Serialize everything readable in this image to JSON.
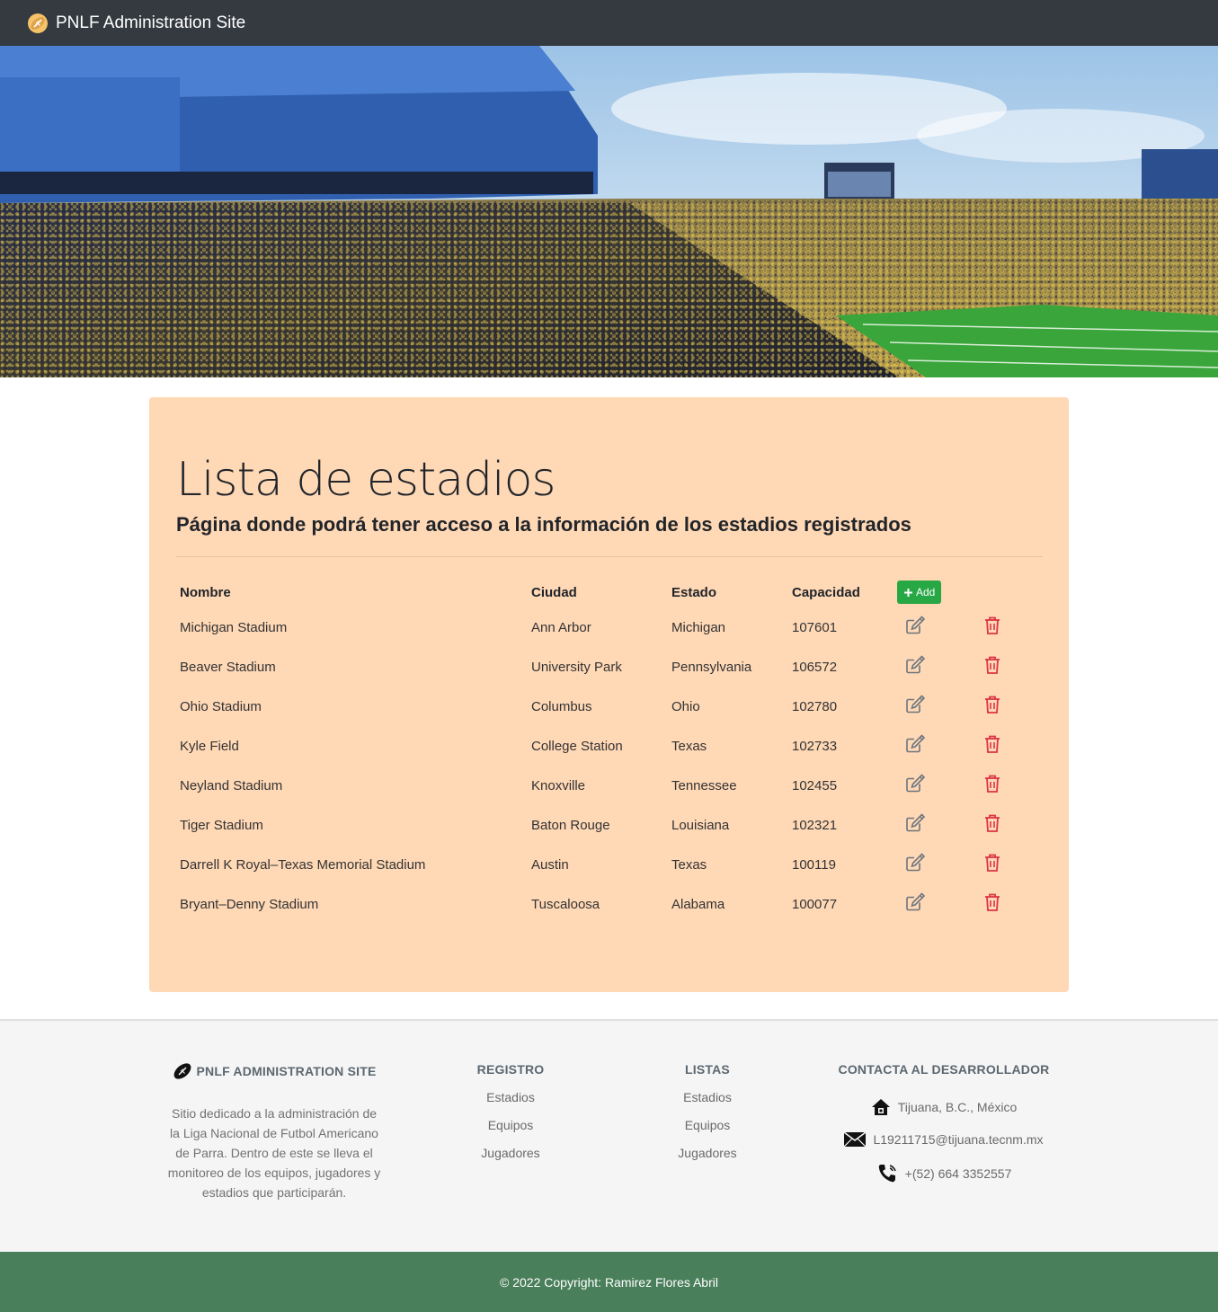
{
  "navbar": {
    "brand": "PNLF Administration Site",
    "brand_icon": "football-icon"
  },
  "hero": {
    "image": "stadium-crowd-photo"
  },
  "page": {
    "title": "Lista de estadios",
    "subtitle": "Página donde podrá tener acceso a la información de los estadios registrados"
  },
  "table": {
    "headers": {
      "name": "Nombre",
      "city": "Ciudad",
      "state": "Estado",
      "capacity": "Capacidad"
    },
    "add_button": "Add",
    "rows": [
      {
        "name": "Michigan Stadium",
        "city": "Ann Arbor",
        "state": "Michigan",
        "capacity": "107601"
      },
      {
        "name": "Beaver Stadium",
        "city": "University Park",
        "state": "Pennsylvania",
        "capacity": "106572"
      },
      {
        "name": "Ohio Stadium",
        "city": "Columbus",
        "state": "Ohio",
        "capacity": "102780"
      },
      {
        "name": "Kyle Field",
        "city": "College Station",
        "state": "Texas",
        "capacity": "102733"
      },
      {
        "name": "Neyland Stadium",
        "city": "Knoxville",
        "state": "Tennessee",
        "capacity": "102455"
      },
      {
        "name": "Tiger Stadium",
        "city": "Baton Rouge",
        "state": "Louisiana",
        "capacity": "102321"
      },
      {
        "name": "Darrell K Royal–Texas Memorial Stadium",
        "city": "Austin",
        "state": "Texas",
        "capacity": "100119"
      },
      {
        "name": "Bryant–Denny Stadium",
        "city": "Tuscaloosa",
        "state": "Alabama",
        "capacity": "100077"
      }
    ]
  },
  "footer": {
    "about": {
      "heading": "PNLF ADMINISTRATION SITE",
      "text": "Sitio dedicado a la administración de la Liga Nacional de Futbol Americano de Parra. Dentro de este se lleva el monitoreo de los equipos, jugadores y estadios que participarán."
    },
    "registro": {
      "heading": "REGISTRO",
      "links": [
        "Estadios",
        "Equipos",
        "Jugadores"
      ]
    },
    "listas": {
      "heading": "LISTAS",
      "links": [
        "Estadios",
        "Equipos",
        "Jugadores"
      ]
    },
    "contact": {
      "heading": "CONTACTA AL DESARROLLADOR",
      "address": "Tijuana, B.C., México",
      "email": "L19211715@tijuana.tecnm.mx",
      "phone": "+(52) 664 3352557"
    },
    "copyright": "© 2022 Copyright: Ramirez Flores Abril"
  },
  "colors": {
    "navbar": "#343a40",
    "card": "#ffd8b6",
    "add_button": "#28a745",
    "delete_icon": "#dc3545",
    "copyright_bar": "#4a7f5b"
  }
}
